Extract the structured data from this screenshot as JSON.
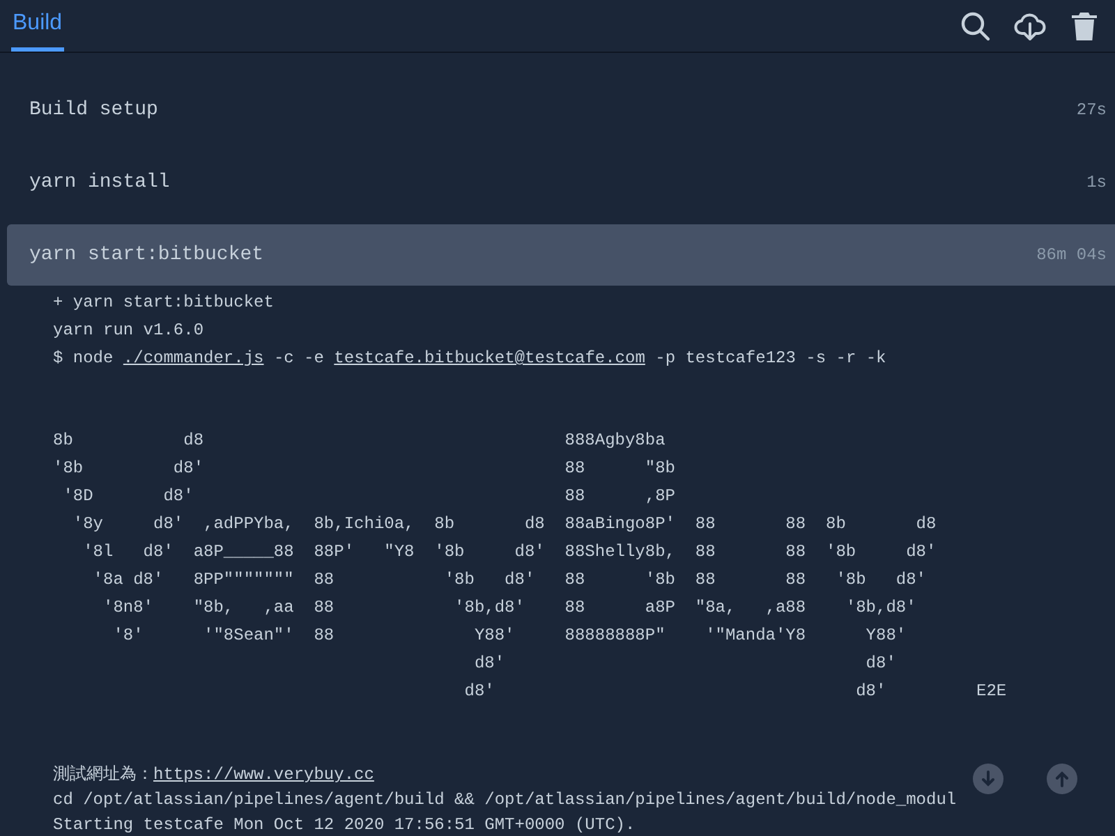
{
  "tabs": [
    {
      "label": "Build",
      "selected": true
    }
  ],
  "steps": [
    {
      "name": "Build setup",
      "duration": "27s",
      "selected": false
    },
    {
      "name": "yarn install",
      "duration": "1s",
      "selected": false
    },
    {
      "name": "yarn start:bitbucket",
      "duration": "86m 04s",
      "selected": true
    }
  ],
  "log": {
    "header_lines": [
      [
        {
          "text": "+ yarn start:bitbucket",
          "link": false
        }
      ],
      [
        {
          "text": "yarn run v1.6.0",
          "link": false
        }
      ],
      [
        {
          "text": "$ node ",
          "link": false
        },
        {
          "text": "./commander.js",
          "link": true
        },
        {
          "text": " -c -e ",
          "link": false
        },
        {
          "text": "testcafe.bitbucket@testcafe.com",
          "link": true
        },
        {
          "text": " -p testcafe123 -s -r -k",
          "link": false
        }
      ]
    ],
    "ascii_art": [
      "8b           d8                                    888Agby8ba",
      "'8b         d8'                                    88      \"8b",
      " '8D       d8'                                     88      ,8P",
      "  '8y     d8'  ,adPPYba,  8b,Ichi0a,  8b       d8  88aBingo8P'  88       88  8b       d8",
      "   '8l   d8'  a8P_____88  88P'   \"Y8  '8b     d8'  88Shelly8b,  88       88  '8b     d8'",
      "    '8a d8'   8PP\"\"\"\"\"\"\"  88           '8b   d8'   88      '8b  88       88   '8b   d8'",
      "     '8n8'    \"8b,   ,aa  88            '8b,d8'    88      a8P  \"8a,   ,a88    '8b,d8'",
      "      '8'      '\"8Sean\"'  88              Y88'     88888888P\"    '\"Manda'Y8      Y88'",
      "                                          d8'                                    d8'",
      "                                         d8'                                    d8'         E2E"
    ],
    "footer_lines": [
      [
        {
          "text": "測試網址為：",
          "link": false
        },
        {
          "text": "https://www.verybuy.cc",
          "link": true
        }
      ],
      [
        {
          "text": "cd /opt/atlassian/pipelines/agent/build && /opt/atlassian/pipelines/agent/build/node_modul",
          "link": false
        }
      ],
      [
        {
          "text": "Starting testcafe Mon Oct 12 2020 17:56:51 GMT+0000 (UTC).",
          "link": false
        }
      ]
    ]
  }
}
